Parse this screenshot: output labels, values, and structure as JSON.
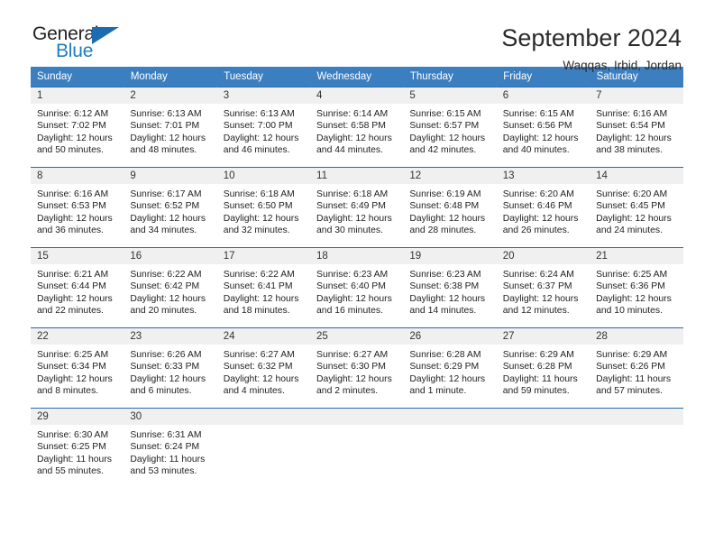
{
  "brand": {
    "name_top": "General",
    "name_bottom": "Blue",
    "triangle_color": "#1b6cb0",
    "blue_text_color": "#1b7ec4"
  },
  "header": {
    "title": "September 2024",
    "subtitle": "Waqqas, Irbid, Jordan"
  },
  "theme": {
    "header_bg": "#3c7fc1",
    "row_border": "#2b6ca8",
    "daynum_bg": "#f0f0f0"
  },
  "weekday_headers": [
    "Sunday",
    "Monday",
    "Tuesday",
    "Wednesday",
    "Thursday",
    "Friday",
    "Saturday"
  ],
  "weeks": [
    [
      {
        "day": "1",
        "sunrise": "Sunrise: 6:12 AM",
        "sunset": "Sunset: 7:02 PM",
        "daylight1": "Daylight: 12 hours",
        "daylight2": "and 50 minutes."
      },
      {
        "day": "2",
        "sunrise": "Sunrise: 6:13 AM",
        "sunset": "Sunset: 7:01 PM",
        "daylight1": "Daylight: 12 hours",
        "daylight2": "and 48 minutes."
      },
      {
        "day": "3",
        "sunrise": "Sunrise: 6:13 AM",
        "sunset": "Sunset: 7:00 PM",
        "daylight1": "Daylight: 12 hours",
        "daylight2": "and 46 minutes."
      },
      {
        "day": "4",
        "sunrise": "Sunrise: 6:14 AM",
        "sunset": "Sunset: 6:58 PM",
        "daylight1": "Daylight: 12 hours",
        "daylight2": "and 44 minutes."
      },
      {
        "day": "5",
        "sunrise": "Sunrise: 6:15 AM",
        "sunset": "Sunset: 6:57 PM",
        "daylight1": "Daylight: 12 hours",
        "daylight2": "and 42 minutes."
      },
      {
        "day": "6",
        "sunrise": "Sunrise: 6:15 AM",
        "sunset": "Sunset: 6:56 PM",
        "daylight1": "Daylight: 12 hours",
        "daylight2": "and 40 minutes."
      },
      {
        "day": "7",
        "sunrise": "Sunrise: 6:16 AM",
        "sunset": "Sunset: 6:54 PM",
        "daylight1": "Daylight: 12 hours",
        "daylight2": "and 38 minutes."
      }
    ],
    [
      {
        "day": "8",
        "sunrise": "Sunrise: 6:16 AM",
        "sunset": "Sunset: 6:53 PM",
        "daylight1": "Daylight: 12 hours",
        "daylight2": "and 36 minutes."
      },
      {
        "day": "9",
        "sunrise": "Sunrise: 6:17 AM",
        "sunset": "Sunset: 6:52 PM",
        "daylight1": "Daylight: 12 hours",
        "daylight2": "and 34 minutes."
      },
      {
        "day": "10",
        "sunrise": "Sunrise: 6:18 AM",
        "sunset": "Sunset: 6:50 PM",
        "daylight1": "Daylight: 12 hours",
        "daylight2": "and 32 minutes."
      },
      {
        "day": "11",
        "sunrise": "Sunrise: 6:18 AM",
        "sunset": "Sunset: 6:49 PM",
        "daylight1": "Daylight: 12 hours",
        "daylight2": "and 30 minutes."
      },
      {
        "day": "12",
        "sunrise": "Sunrise: 6:19 AM",
        "sunset": "Sunset: 6:48 PM",
        "daylight1": "Daylight: 12 hours",
        "daylight2": "and 28 minutes."
      },
      {
        "day": "13",
        "sunrise": "Sunrise: 6:20 AM",
        "sunset": "Sunset: 6:46 PM",
        "daylight1": "Daylight: 12 hours",
        "daylight2": "and 26 minutes."
      },
      {
        "day": "14",
        "sunrise": "Sunrise: 6:20 AM",
        "sunset": "Sunset: 6:45 PM",
        "daylight1": "Daylight: 12 hours",
        "daylight2": "and 24 minutes."
      }
    ],
    [
      {
        "day": "15",
        "sunrise": "Sunrise: 6:21 AM",
        "sunset": "Sunset: 6:44 PM",
        "daylight1": "Daylight: 12 hours",
        "daylight2": "and 22 minutes."
      },
      {
        "day": "16",
        "sunrise": "Sunrise: 6:22 AM",
        "sunset": "Sunset: 6:42 PM",
        "daylight1": "Daylight: 12 hours",
        "daylight2": "and 20 minutes."
      },
      {
        "day": "17",
        "sunrise": "Sunrise: 6:22 AM",
        "sunset": "Sunset: 6:41 PM",
        "daylight1": "Daylight: 12 hours",
        "daylight2": "and 18 minutes."
      },
      {
        "day": "18",
        "sunrise": "Sunrise: 6:23 AM",
        "sunset": "Sunset: 6:40 PM",
        "daylight1": "Daylight: 12 hours",
        "daylight2": "and 16 minutes."
      },
      {
        "day": "19",
        "sunrise": "Sunrise: 6:23 AM",
        "sunset": "Sunset: 6:38 PM",
        "daylight1": "Daylight: 12 hours",
        "daylight2": "and 14 minutes."
      },
      {
        "day": "20",
        "sunrise": "Sunrise: 6:24 AM",
        "sunset": "Sunset: 6:37 PM",
        "daylight1": "Daylight: 12 hours",
        "daylight2": "and 12 minutes."
      },
      {
        "day": "21",
        "sunrise": "Sunrise: 6:25 AM",
        "sunset": "Sunset: 6:36 PM",
        "daylight1": "Daylight: 12 hours",
        "daylight2": "and 10 minutes."
      }
    ],
    [
      {
        "day": "22",
        "sunrise": "Sunrise: 6:25 AM",
        "sunset": "Sunset: 6:34 PM",
        "daylight1": "Daylight: 12 hours",
        "daylight2": "and 8 minutes."
      },
      {
        "day": "23",
        "sunrise": "Sunrise: 6:26 AM",
        "sunset": "Sunset: 6:33 PM",
        "daylight1": "Daylight: 12 hours",
        "daylight2": "and 6 minutes."
      },
      {
        "day": "24",
        "sunrise": "Sunrise: 6:27 AM",
        "sunset": "Sunset: 6:32 PM",
        "daylight1": "Daylight: 12 hours",
        "daylight2": "and 4 minutes."
      },
      {
        "day": "25",
        "sunrise": "Sunrise: 6:27 AM",
        "sunset": "Sunset: 6:30 PM",
        "daylight1": "Daylight: 12 hours",
        "daylight2": "and 2 minutes."
      },
      {
        "day": "26",
        "sunrise": "Sunrise: 6:28 AM",
        "sunset": "Sunset: 6:29 PM",
        "daylight1": "Daylight: 12 hours",
        "daylight2": "and 1 minute."
      },
      {
        "day": "27",
        "sunrise": "Sunrise: 6:29 AM",
        "sunset": "Sunset: 6:28 PM",
        "daylight1": "Daylight: 11 hours",
        "daylight2": "and 59 minutes."
      },
      {
        "day": "28",
        "sunrise": "Sunrise: 6:29 AM",
        "sunset": "Sunset: 6:26 PM",
        "daylight1": "Daylight: 11 hours",
        "daylight2": "and 57 minutes."
      }
    ],
    [
      {
        "day": "29",
        "sunrise": "Sunrise: 6:30 AM",
        "sunset": "Sunset: 6:25 PM",
        "daylight1": "Daylight: 11 hours",
        "daylight2": "and 55 minutes."
      },
      {
        "day": "30",
        "sunrise": "Sunrise: 6:31 AM",
        "sunset": "Sunset: 6:24 PM",
        "daylight1": "Daylight: 11 hours",
        "daylight2": "and 53 minutes."
      },
      {
        "day": "",
        "sunrise": "",
        "sunset": "",
        "daylight1": "",
        "daylight2": ""
      },
      {
        "day": "",
        "sunrise": "",
        "sunset": "",
        "daylight1": "",
        "daylight2": ""
      },
      {
        "day": "",
        "sunrise": "",
        "sunset": "",
        "daylight1": "",
        "daylight2": ""
      },
      {
        "day": "",
        "sunrise": "",
        "sunset": "",
        "daylight1": "",
        "daylight2": ""
      },
      {
        "day": "",
        "sunrise": "",
        "sunset": "",
        "daylight1": "",
        "daylight2": ""
      }
    ]
  ]
}
